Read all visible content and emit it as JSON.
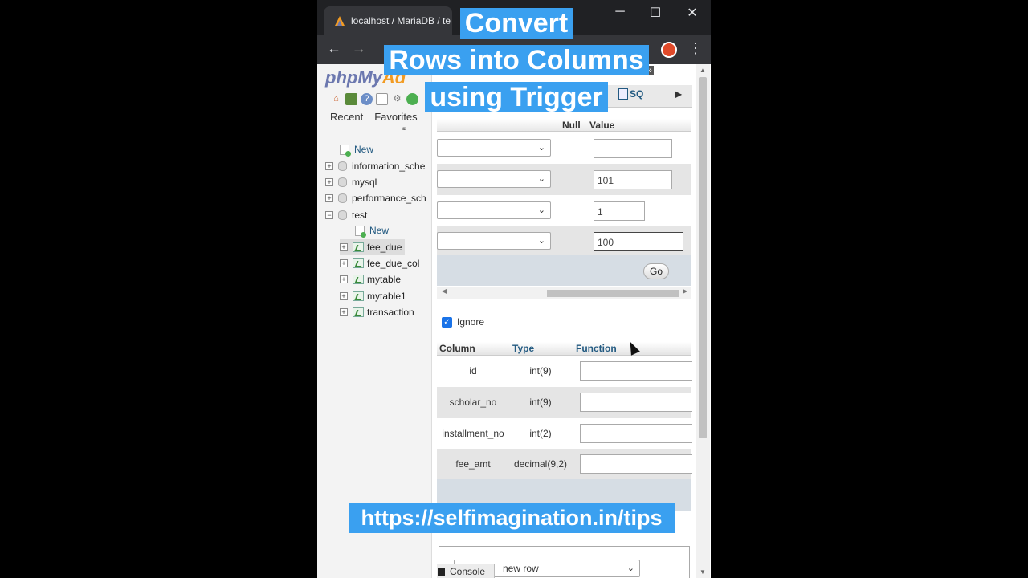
{
  "browser": {
    "tab_title": "localhost / MariaDB / te",
    "window_controls": {
      "minimize": "─",
      "maximize": "☐",
      "close": "✕"
    },
    "nav": {
      "back": "←",
      "forward": "→",
      "menu": "⋮"
    }
  },
  "sidebar": {
    "logo_main": "phpMy",
    "logo_accent": "Ad",
    "recent_label": "Recent",
    "favorites_label": "Favorites",
    "tree": {
      "new_label": "New",
      "databases": [
        "information_sche",
        "mysql",
        "performance_sch",
        "test"
      ],
      "test_new_label": "New",
      "tables": [
        "fee_due",
        "fee_due_col",
        "mytable",
        "mytable1",
        "transaction"
      ]
    }
  },
  "main": {
    "breadcrumb_tail": "ost » ",
    "sql_tab": "SQ",
    "value_headers": {
      "null": "Null",
      "value": "Value"
    },
    "value_inputs": [
      "",
      "101",
      "1",
      "100"
    ],
    "go_button": "Go",
    "ignore_label": "Ignore",
    "column_headers": {
      "column": "Column",
      "type": "Type",
      "function": "Function"
    },
    "columns": [
      {
        "name": "id",
        "type": "int(9)"
      },
      {
        "name": "scholar_no",
        "type": "int(9)"
      },
      {
        "name": "installment_no",
        "type": "int(2)"
      },
      {
        "name": "fee_amt",
        "type": "decimal(9,2)"
      }
    ],
    "new_row_select": "new row",
    "console_label": "Console"
  },
  "overlay": {
    "caption_lines": [
      "Convert",
      "Rows into Columns",
      "using Trigger"
    ],
    "url": "https://selfimagination.in/tips"
  },
  "colors": {
    "caption_bg": "#3aa0f0",
    "pma_link": "#235a81",
    "chrome_dark": "#202124"
  }
}
